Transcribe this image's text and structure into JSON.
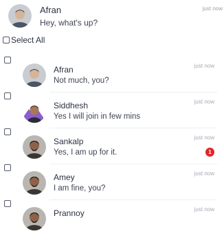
{
  "top_message": {
    "name": "Afran",
    "text": "Hey, what's up?",
    "time": "just now"
  },
  "select_all": {
    "label": "Select All"
  },
  "conversations": [
    {
      "name": "Afran",
      "text": "Not much, you?",
      "time": "just now",
      "unread": ""
    },
    {
      "name": "Siddhesh",
      "text": "Yes I will join in few mins",
      "time": "just now",
      "unread": ""
    },
    {
      "name": "Sankalp",
      "text": "Yes, I am up for it.",
      "time": "just now",
      "unread": "1"
    },
    {
      "name": "Amey",
      "text": "I am fine, you?",
      "time": "just now",
      "unread": ""
    },
    {
      "name": "Prannoy",
      "text": "",
      "time": "just now",
      "unread": ""
    }
  ],
  "colors": {
    "badge": "#e0242a",
    "time": "#a4a9b3",
    "text": "#2b3142"
  },
  "icons": {
    "checkbox": "checkbox-icon",
    "avatar": "avatar"
  }
}
